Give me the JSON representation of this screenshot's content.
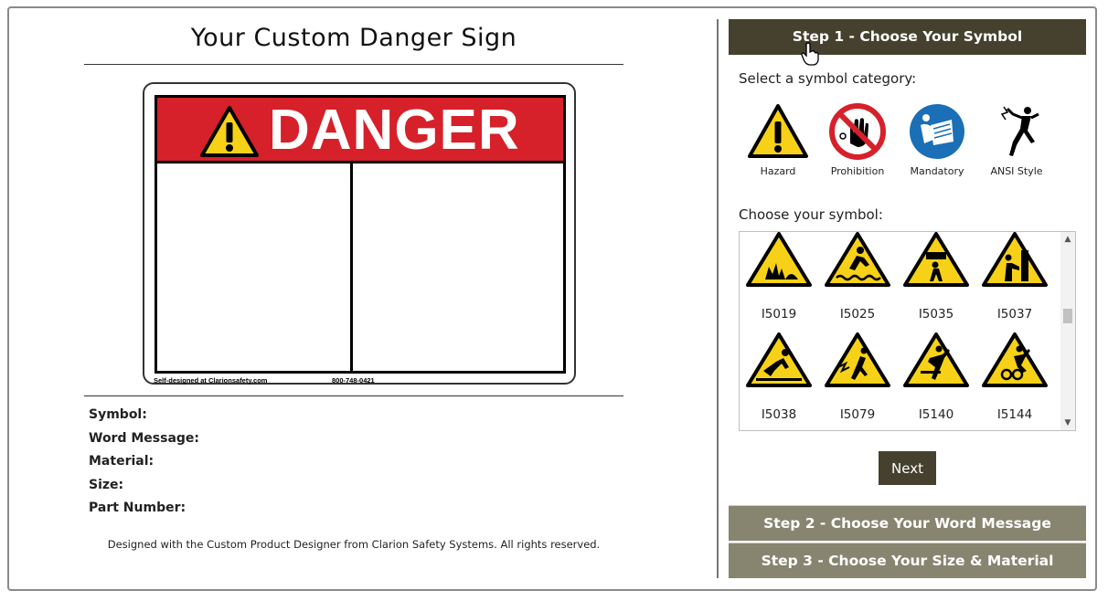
{
  "preview": {
    "title": "Your Custom Danger Sign",
    "sign": {
      "signal_word": "DANGER",
      "footer_left": "Self-designed at Clarionsafety.com",
      "footer_right": "800-748-0421",
      "colors": {
        "header": "#d6202a",
        "text": "#ffffff",
        "border": "#000000"
      }
    },
    "details": {
      "symbol_label": "Symbol:",
      "word_message_label": "Word Message:",
      "material_label": "Material:",
      "size_label": "Size:",
      "part_number_label": "Part Number:"
    },
    "copyright": "Designed with the Custom Product Designer from Clarion Safety Systems. All rights reserved."
  },
  "steps": {
    "step1": {
      "label": "Step 1 - Choose Your Symbol",
      "color": "#45412e"
    },
    "step2": {
      "label": "Step 2 - Choose Your Word Message",
      "color": "#878470"
    },
    "step3": {
      "label": "Step 3 - Choose Your Size & Material",
      "color": "#878470"
    }
  },
  "category": {
    "prompt": "Select a symbol category:",
    "items": [
      {
        "label": "Hazard",
        "icon": "hazard-triangle-icon"
      },
      {
        "label": "Prohibition",
        "icon": "prohibition-icon"
      },
      {
        "label": "Mandatory",
        "icon": "mandatory-icon"
      },
      {
        "label": "ANSI Style",
        "icon": "ansi-style-icon"
      }
    ]
  },
  "symbols": {
    "prompt": "Choose your symbol:",
    "items": [
      {
        "code": "I5019",
        "icon": "explosion-hazard-icon"
      },
      {
        "code": "I5025",
        "icon": "drowning-hazard-icon"
      },
      {
        "code": "I5035",
        "icon": "falling-object-icon"
      },
      {
        "code": "I5037",
        "icon": "crush-hazard-icon"
      },
      {
        "code": "I5038",
        "icon": "slip-fall-icon"
      },
      {
        "code": "I5079",
        "icon": "electric-shock-icon"
      },
      {
        "code": "I5140",
        "icon": "trip-hazard-icon"
      },
      {
        "code": "I5144",
        "icon": "entanglement-icon"
      }
    ]
  },
  "actions": {
    "next_label": "Next"
  }
}
